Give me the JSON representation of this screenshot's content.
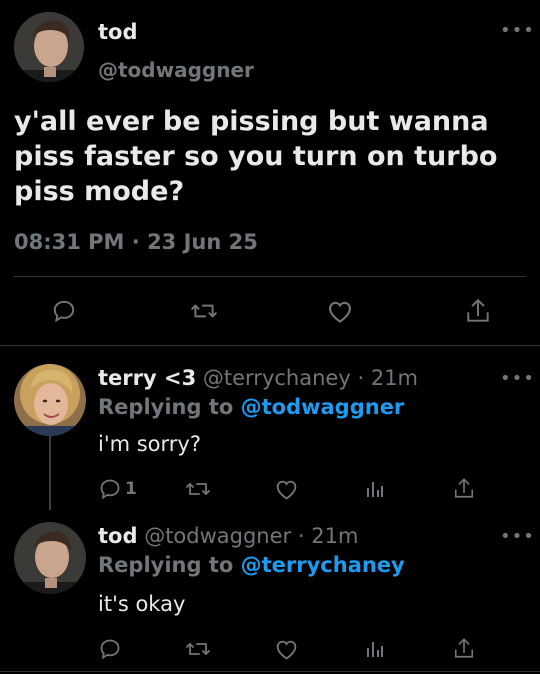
{
  "main_tweet": {
    "display_name": "tod",
    "handle": "@todwaggner",
    "text_lines": [
      "y'all ever be pissing but wanna",
      "piss faster so you turn on turbo",
      "piss mode?"
    ],
    "time": "08:31 PM",
    "dot": "·",
    "date": "23 Jun 25",
    "more_icon": "more-icon"
  },
  "replies": [
    {
      "display_name": "terry <3",
      "handle": "@terrychaney",
      "separator": "·",
      "age": "21m",
      "replying_label": "Replying to",
      "replying_handle": "@todwaggner",
      "text": "i'm sorry?",
      "reply_count": "1"
    },
    {
      "display_name": "tod",
      "handle": "@todwaggner",
      "separator": "·",
      "age": "21m",
      "replying_label": "Replying to",
      "replying_handle": "@terrychaney",
      "text": "it's okay",
      "reply_count": ""
    }
  ],
  "colors": {
    "background": "#000000",
    "text": "#e7e9ea",
    "muted": "#71767b",
    "accent": "#1d9bf0",
    "divider": "#2f3336"
  }
}
